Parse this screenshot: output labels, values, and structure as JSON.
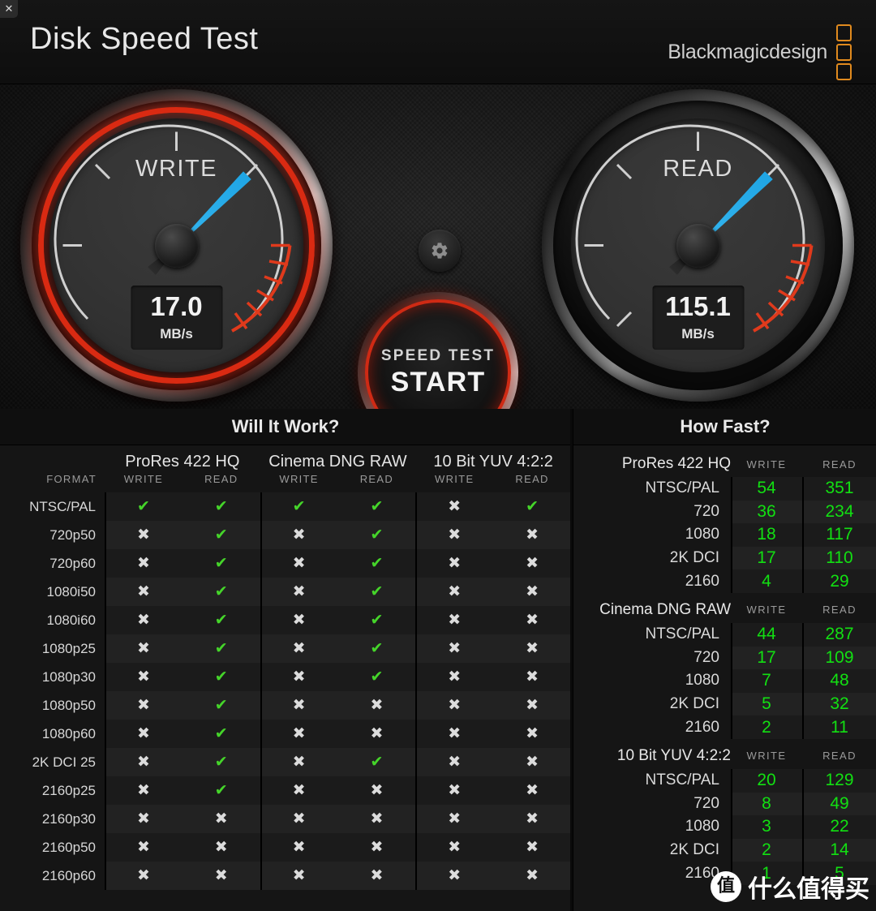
{
  "window": {
    "close_label": "✕"
  },
  "header": {
    "title": "Disk Speed Test",
    "brand": "Blackmagicdesign",
    "brand_color": "#e08a1e"
  },
  "gauges": {
    "write": {
      "label": "WRITE",
      "value": "17.0",
      "unit": "MB/s"
    },
    "read": {
      "label": "READ",
      "value": "115.1",
      "unit": "MB/s"
    },
    "needle_color": "#22a9e6",
    "redzone_color": "#d92a12"
  },
  "center": {
    "settings_icon": "gear-icon",
    "start_line1": "SPEED TEST",
    "start_line2": "START"
  },
  "will_it_work": {
    "title": "Will It Work?",
    "format_header": "FORMAT",
    "codecs": [
      "ProRes 422 HQ",
      "Cinema DNG RAW",
      "10 Bit YUV 4:2:2"
    ],
    "sub_headers": [
      "WRITE",
      "READ"
    ],
    "ok_glyph": "✔",
    "no_glyph": "✖",
    "rows": [
      {
        "format": "NTSC/PAL",
        "cells": [
          true,
          true,
          true,
          true,
          false,
          true
        ]
      },
      {
        "format": "720p50",
        "cells": [
          false,
          true,
          false,
          true,
          false,
          false
        ]
      },
      {
        "format": "720p60",
        "cells": [
          false,
          true,
          false,
          true,
          false,
          false
        ]
      },
      {
        "format": "1080i50",
        "cells": [
          false,
          true,
          false,
          true,
          false,
          false
        ]
      },
      {
        "format": "1080i60",
        "cells": [
          false,
          true,
          false,
          true,
          false,
          false
        ]
      },
      {
        "format": "1080p25",
        "cells": [
          false,
          true,
          false,
          true,
          false,
          false
        ]
      },
      {
        "format": "1080p30",
        "cells": [
          false,
          true,
          false,
          true,
          false,
          false
        ]
      },
      {
        "format": "1080p50",
        "cells": [
          false,
          true,
          false,
          false,
          false,
          false
        ]
      },
      {
        "format": "1080p60",
        "cells": [
          false,
          true,
          false,
          false,
          false,
          false
        ]
      },
      {
        "format": "2K DCI 25",
        "cells": [
          false,
          true,
          false,
          true,
          false,
          false
        ]
      },
      {
        "format": "2160p25",
        "cells": [
          false,
          true,
          false,
          false,
          false,
          false
        ]
      },
      {
        "format": "2160p30",
        "cells": [
          false,
          false,
          false,
          false,
          false,
          false
        ]
      },
      {
        "format": "2160p50",
        "cells": [
          false,
          false,
          false,
          false,
          false,
          false
        ]
      },
      {
        "format": "2160p60",
        "cells": [
          false,
          false,
          false,
          false,
          false,
          false
        ]
      }
    ]
  },
  "how_fast": {
    "title": "How Fast?",
    "sub_headers": [
      "WRITE",
      "READ"
    ],
    "value_color": "#12e012",
    "blocks": [
      {
        "codec": "ProRes 422 HQ",
        "rows": [
          {
            "resolution": "NTSC/PAL",
            "write": "54",
            "read": "351"
          },
          {
            "resolution": "720",
            "write": "36",
            "read": "234"
          },
          {
            "resolution": "1080",
            "write": "18",
            "read": "117"
          },
          {
            "resolution": "2K DCI",
            "write": "17",
            "read": "110"
          },
          {
            "resolution": "2160",
            "write": "4",
            "read": "29"
          }
        ]
      },
      {
        "codec": "Cinema DNG RAW",
        "rows": [
          {
            "resolution": "NTSC/PAL",
            "write": "44",
            "read": "287"
          },
          {
            "resolution": "720",
            "write": "17",
            "read": "109"
          },
          {
            "resolution": "1080",
            "write": "7",
            "read": "48"
          },
          {
            "resolution": "2K DCI",
            "write": "5",
            "read": "32"
          },
          {
            "resolution": "2160",
            "write": "2",
            "read": "11"
          }
        ]
      },
      {
        "codec": "10 Bit YUV 4:2:2",
        "rows": [
          {
            "resolution": "NTSC/PAL",
            "write": "20",
            "read": "129"
          },
          {
            "resolution": "720",
            "write": "8",
            "read": "49"
          },
          {
            "resolution": "1080",
            "write": "3",
            "read": "22"
          },
          {
            "resolution": "2K DCI",
            "write": "2",
            "read": "14"
          },
          {
            "resolution": "2160",
            "write": "1",
            "read": "5"
          }
        ]
      }
    ]
  },
  "watermark": {
    "badge": "值",
    "text": "什么值得买"
  }
}
